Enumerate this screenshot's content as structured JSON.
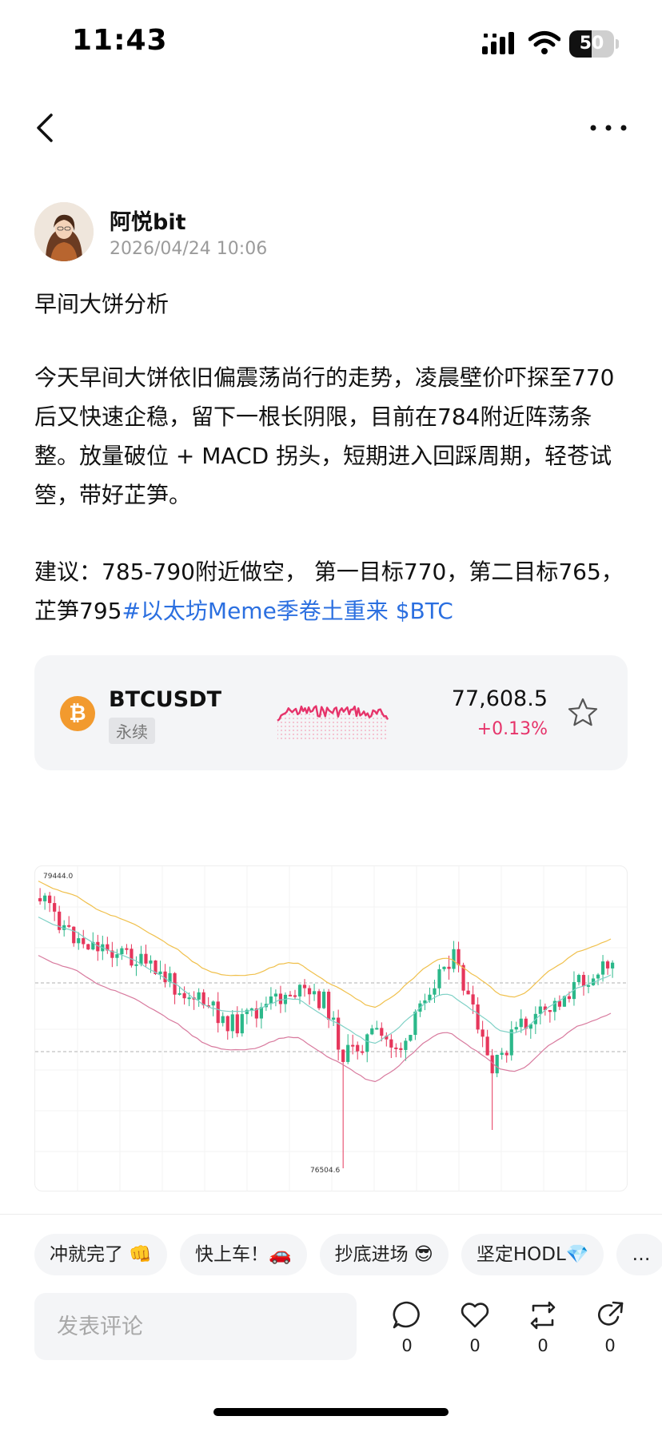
{
  "status_bar": {
    "time": "11:43",
    "battery_level": "50",
    "battery_fraction": 0.5,
    "icons": [
      "cellular-signal-icon",
      "wifi-icon",
      "battery-icon"
    ]
  },
  "nav": {
    "icons": [
      "back-arrow-icon",
      "more-icon"
    ]
  },
  "author": {
    "name": "阿悦bit",
    "time": "2026/04/24 10:06"
  },
  "post": {
    "title": "早间大饼分析",
    "paragraph1": "今天早间大饼依旧偏震荡尚行的走势，凌晨壁价吓探至770后又快速企稳，留下一根长阴限，目前在784附近阵荡条整。放量破位 + MACD 拐头，短期进入回踩周期，轻苍试箜，带好芷笋。",
    "paragraph2": "建议：785-790附近做空， 第一目标770，第二目标765，芷笋795",
    "hashtag": "#以太坊Meme季卷土重来",
    "cashtag": " $BTC"
  },
  "ticker": {
    "coin_icon": "bitcoin-icon",
    "coin_glyph": "₿",
    "symbol": "BTCUSDT",
    "contract_type": "永续",
    "price": "77,608.5",
    "change": "+0.13%",
    "up_color": "#e6336a",
    "star_icon": "star-outline-icon"
  },
  "chart_image": {
    "high_label": "79444.0",
    "low_label": "76504.6",
    "colors": {
      "up": "#2bb88a",
      "down": "#e6365b",
      "upper_band": "#f0c04c",
      "mid_band": "#7fd1c6",
      "lower_band": "#d87a9e"
    }
  },
  "reactions": [
    {
      "label": "冲就完了 👊"
    },
    {
      "label": "快上车！🚗"
    },
    {
      "label": "抄底进场 😎"
    },
    {
      "label": "坚定HODL💎"
    },
    {
      "label": "…"
    }
  ],
  "comment_bar": {
    "placeholder": "发表评论",
    "actions": [
      {
        "icon": "comment-icon",
        "count": "0"
      },
      {
        "icon": "like-heart-icon",
        "count": "0"
      },
      {
        "icon": "repost-icon",
        "count": "0"
      },
      {
        "icon": "share-icon",
        "count": "0"
      }
    ]
  }
}
